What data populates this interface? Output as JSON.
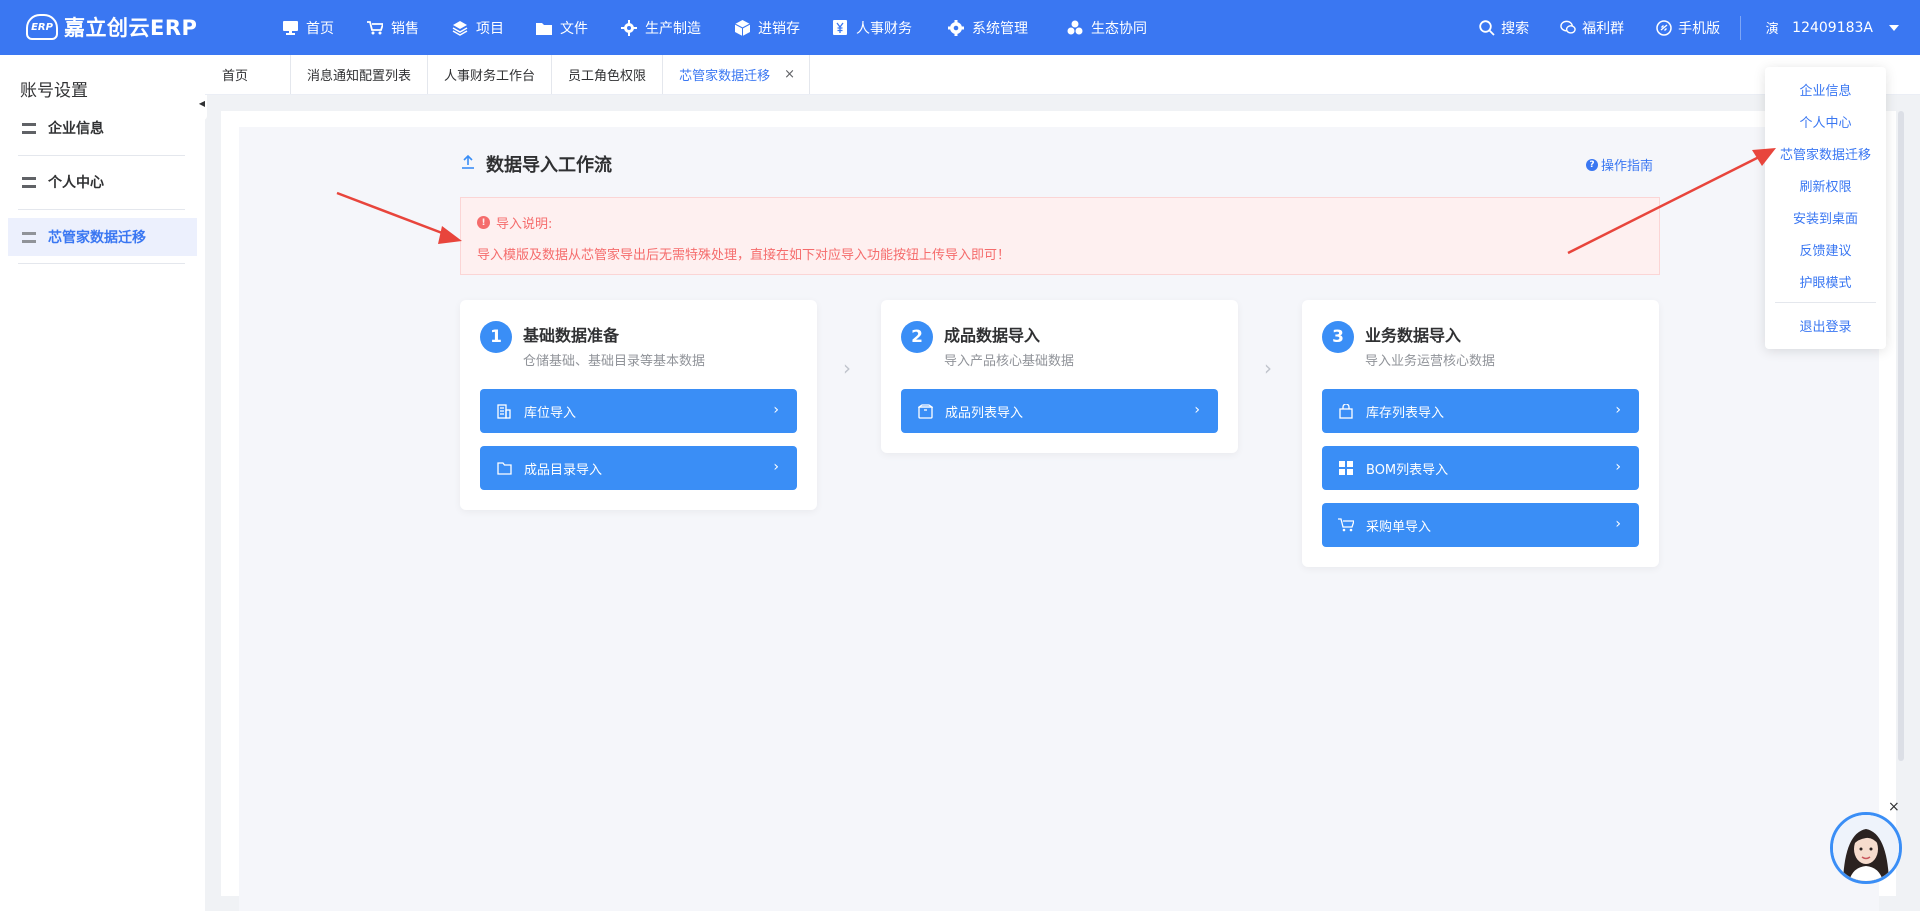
{
  "app": {
    "logo_mark": "ERP",
    "logo_text": "嘉立创云ERP"
  },
  "nav": [
    {
      "label": "首页",
      "icon": "monitor-icon"
    },
    {
      "label": "销售",
      "icon": "cart-icon"
    },
    {
      "label": "项目",
      "icon": "layers-icon"
    },
    {
      "label": "文件",
      "icon": "folder-icon"
    },
    {
      "label": "生产制造",
      "icon": "gear-icon"
    },
    {
      "label": "进销存",
      "icon": "cube-icon"
    },
    {
      "label": "人事财务",
      "icon": "yen-icon"
    },
    {
      "label": "系统管理",
      "icon": "settings-icon"
    },
    {
      "label": "生态协同",
      "icon": "cluster-icon"
    }
  ],
  "topright": {
    "search": "搜索",
    "welfare": "福利群",
    "mobile": "手机版",
    "avatar_char": "演",
    "user": "12409183A"
  },
  "sidebar": {
    "title": "账号设置",
    "items": [
      {
        "label": "企业信息"
      },
      {
        "label": "个人中心"
      },
      {
        "label": "芯管家数据迁移"
      }
    ]
  },
  "tabs": [
    {
      "label": "首页"
    },
    {
      "label": "消息通知配置列表"
    },
    {
      "label": "人事财务工作台"
    },
    {
      "label": "员工角色权限"
    },
    {
      "label": "芯管家数据迁移",
      "close": "×"
    }
  ],
  "workflow": {
    "title": "数据导入工作流",
    "guide": "操作指南",
    "guide_icon": "?",
    "notice_icon": "!",
    "notice_title": "导入说明:",
    "notice_text": "导入模版及数据从芯管家导出后无需特殊处理，直接在如下对应导入功能按钮上传导入即可！",
    "steps": [
      {
        "num": "1",
        "title": "基础数据准备",
        "sub": "仓储基础、基础目录等基本数据",
        "buttons": [
          {
            "label": "库位导入"
          },
          {
            "label": "成品目录导入"
          }
        ]
      },
      {
        "num": "2",
        "title": "成品数据导入",
        "sub": "导入产品核心基础数据",
        "buttons": [
          {
            "label": "成品列表导入"
          }
        ]
      },
      {
        "num": "3",
        "title": "业务数据导入",
        "sub": "导入业务运营核心数据",
        "buttons": [
          {
            "label": "库存列表导入"
          },
          {
            "label": "BOM列表导入"
          },
          {
            "label": "采购单导入"
          }
        ]
      }
    ]
  },
  "dropdown": [
    {
      "label": "企业信息"
    },
    {
      "label": "个人中心"
    },
    {
      "label": "芯管家数据迁移"
    },
    {
      "label": "刷新权限"
    },
    {
      "label": "安装到桌面"
    },
    {
      "label": "反馈建议"
    },
    {
      "label": "护眼模式"
    },
    {
      "label": "退出登录"
    }
  ],
  "glyphs": {
    "chevron": "›",
    "close": "×"
  },
  "colors": {
    "brand": "#3a77f2",
    "button": "#3a8ef6",
    "notice": "#f56c6c",
    "annotation_arrow": "#e8453c"
  }
}
